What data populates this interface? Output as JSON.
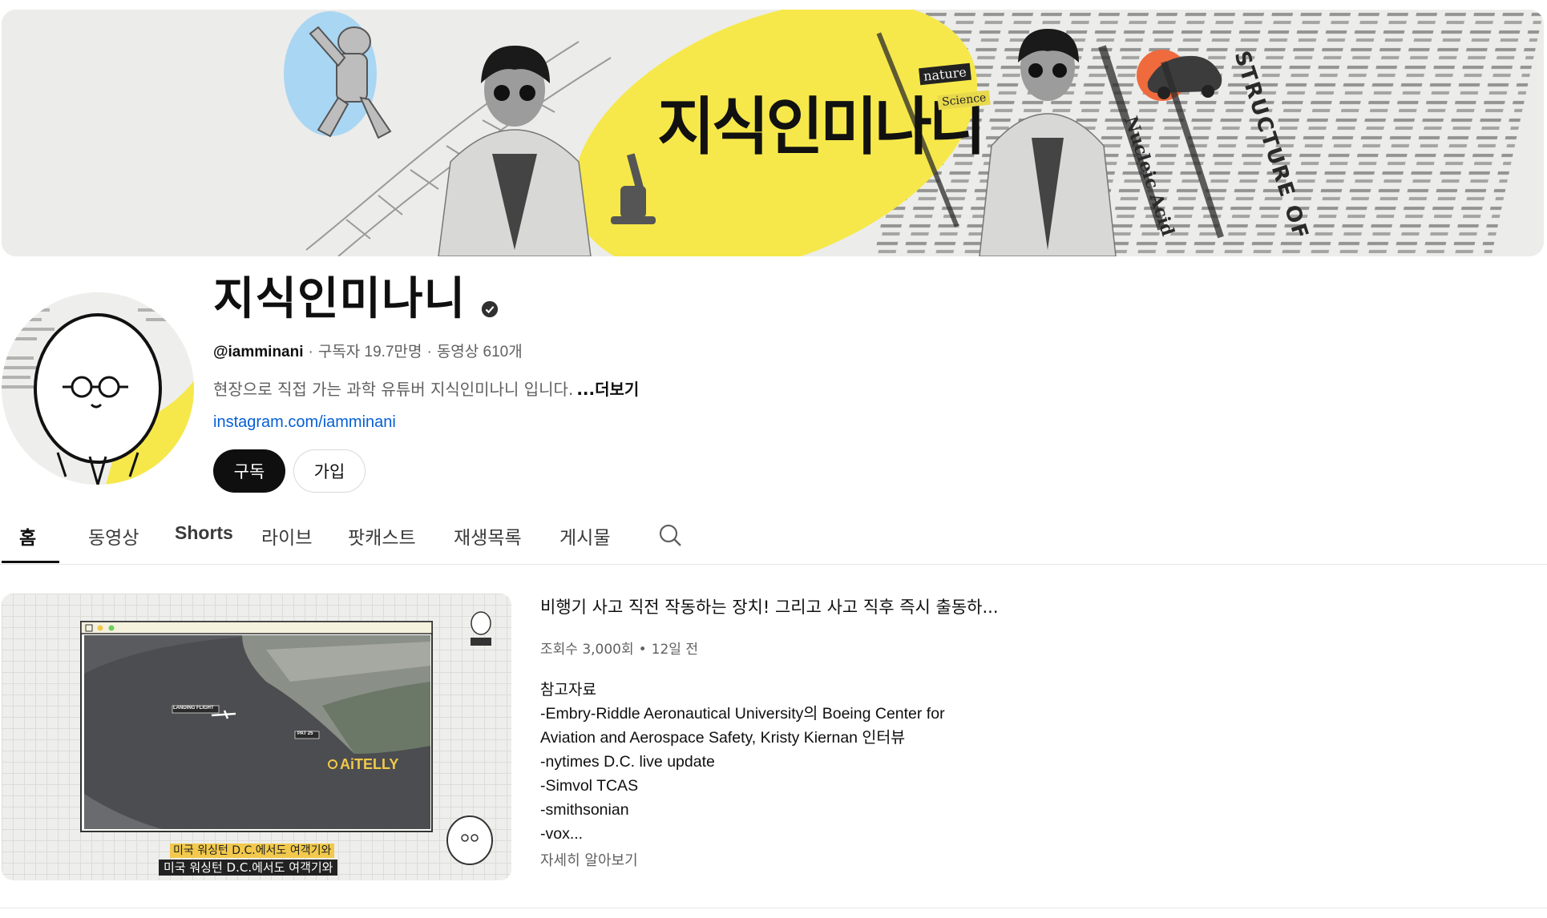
{
  "banner": {
    "title": "지식인미나니",
    "tag_nature": "nature",
    "tag_science": "Science",
    "text_nucleic": "Nucleic Acid",
    "text_structure": "STRUCTURE OF"
  },
  "channel": {
    "name": "지식인미나니",
    "handle": "@iamminani",
    "subscribers": "구독자 19.7만명",
    "videos": "동영상 610개",
    "description": "현장으로 직접 가는 과학 유튜버 지식인미나니 입니다.",
    "more_label": "...더보기",
    "link": "instagram.com/iamminani",
    "subscribe_label": "구독",
    "join_label": "가입"
  },
  "tabs": [
    {
      "label": "홈",
      "active": true
    },
    {
      "label": "동영상",
      "active": false
    },
    {
      "label": "Shorts",
      "active": false
    },
    {
      "label": "라이브",
      "active": false
    },
    {
      "label": "팟캐스트",
      "active": false
    },
    {
      "label": "재생목록",
      "active": false
    },
    {
      "label": "게시물",
      "active": false
    }
  ],
  "featured": {
    "title": "비행기 사고 직전 작동하는 장치! 그리고 사고 직후 즉시 출동하...",
    "views": "조회수 3,000회",
    "age": "12일 전",
    "description_lines": [
      "참고자료",
      "-Embry-Riddle Aeronautical University의 Boeing Center for",
      "Aviation and Aerospace Safety, Kristy Kiernan 인터뷰",
      "-nytimes D.C. live update",
      "-Simvol TCAS",
      "-smithsonian",
      "-vox..."
    ],
    "read_more": "자세히 알아보기",
    "thumbnail": {
      "caption_top": "미국 워싱턴 D.C.에서도 여객기와",
      "caption_bottom": "미국 워싱턴 D.C.에서도 여객기와",
      "watermark": "AiTELLY",
      "label_landing": "LANDING FLIGHT",
      "label_pat": "PAT 25"
    }
  },
  "colors": {
    "accent_yellow": "#f6e84a",
    "link_blue": "#065fd4",
    "subscribe_bg": "#0f0f0f"
  }
}
